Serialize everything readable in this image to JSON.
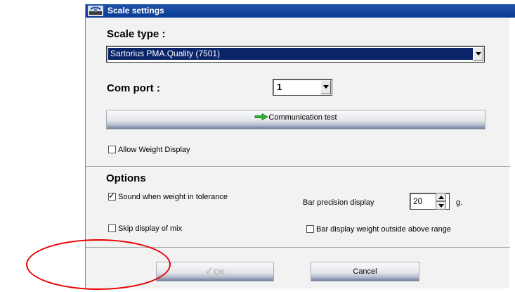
{
  "window": {
    "title": "Scale settings"
  },
  "scale_type": {
    "heading": "Scale type :",
    "value": "Sartorius PMA.Quality (7501)"
  },
  "com_port": {
    "heading": "Com port :",
    "value": "1"
  },
  "communication_test": {
    "label": "Communication test"
  },
  "allow_weight_display": {
    "label": "Allow Weight Display",
    "checked": false
  },
  "options": {
    "heading": "Options",
    "sound_tolerance": {
      "label": "Sound when weight in tolerance",
      "checked": true
    },
    "skip_display_mix": {
      "label": "Skip display of mix",
      "checked": false
    },
    "bar_precision": {
      "label": "Bar precision display",
      "value": "20",
      "unit": "g."
    },
    "bar_outside_range": {
      "label": "Bar display weight outside above range",
      "checked": false
    }
  },
  "buttons": {
    "ok": "OK",
    "cancel": "Cancel"
  },
  "colors": {
    "titlebar": "#0a3a94",
    "selection": "#0a246a",
    "annotation": "#e60000",
    "arrow": "#2db52d"
  }
}
